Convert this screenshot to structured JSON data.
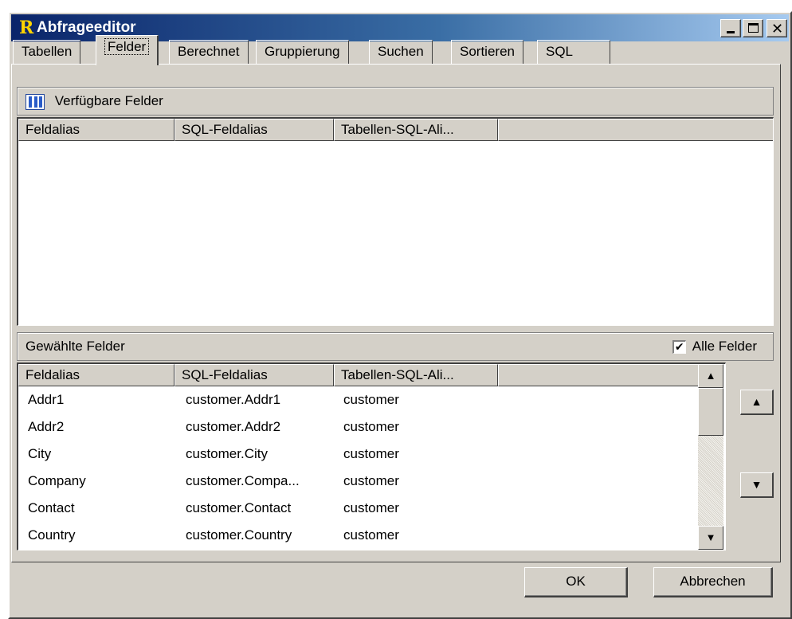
{
  "window": {
    "title": "Abfrageeditor",
    "icon_letter": "R"
  },
  "tabs": [
    {
      "label": "Tabellen",
      "active": false
    },
    {
      "label": "Felder",
      "active": true
    },
    {
      "label": "Berechnet",
      "active": false
    },
    {
      "label": "Gruppierung",
      "active": false
    },
    {
      "label": "Suchen",
      "active": false
    },
    {
      "label": "Sortieren",
      "active": false
    },
    {
      "label": "SQL",
      "active": false
    }
  ],
  "available": {
    "title": "Verfügbare Felder",
    "columns": [
      "Feldalias",
      "SQL-Feldalias",
      "Tabellen-SQL-Ali..."
    ],
    "rows": []
  },
  "selected": {
    "title": "Gewählte Felder",
    "all_fields_label": "Alle Felder",
    "all_fields_checked": true,
    "columns": [
      "Feldalias",
      "SQL-Feldalias",
      "Tabellen-SQL-Ali..."
    ],
    "rows": [
      [
        "Addr1",
        "customer.Addr1",
        "customer"
      ],
      [
        "Addr2",
        "customer.Addr2",
        "customer"
      ],
      [
        "City",
        "customer.City",
        "customer"
      ],
      [
        "Company",
        "customer.Compa...",
        "customer"
      ],
      [
        "Contact",
        "customer.Contact",
        "customer"
      ],
      [
        "Country",
        "customer.Country",
        "customer"
      ]
    ]
  },
  "buttons": {
    "ok": "OK",
    "cancel": "Abbrechen"
  },
  "colors": {
    "titlebar_start": "#0a246a",
    "titlebar_end": "#a6caf0",
    "face": "#d4d0c8"
  }
}
